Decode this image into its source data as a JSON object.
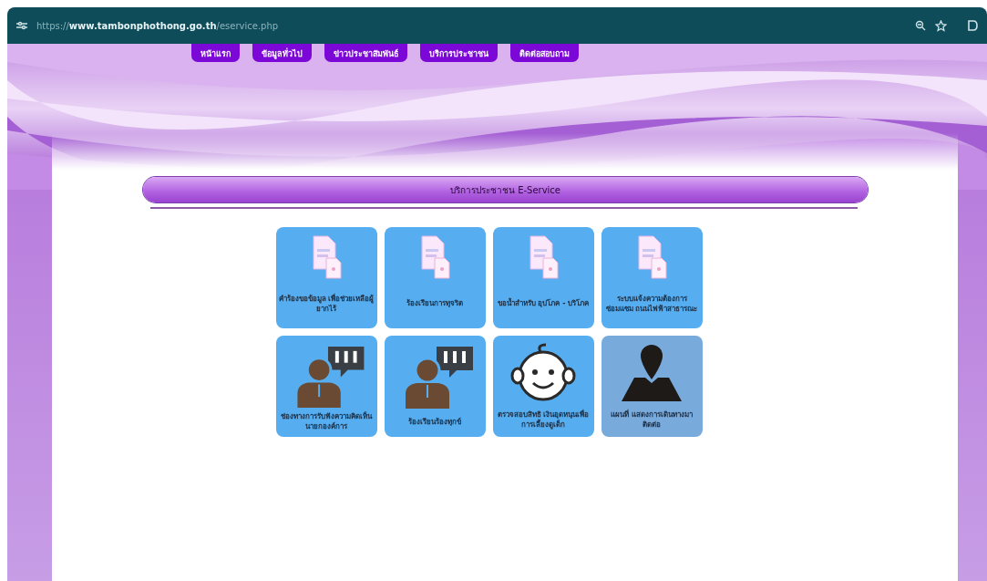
{
  "browser": {
    "url_scheme": "https://",
    "url_host": "www.tambonphothong.go.th",
    "url_path": "/eservice.php"
  },
  "nav": [
    "หน้าแรก",
    "ข้อมูลทั่วไป",
    "ข่าวประชาสัมพันธ์",
    "บริการประชาชน",
    "ติดต่อสอบถาม"
  ],
  "section_title": "บริการประชาชน E-Service",
  "services": [
    {
      "kind": "document",
      "label": "คำร้องขอข้อมูล เพื่อช่วยเหลือผู้ยากไร้"
    },
    {
      "kind": "document",
      "label": "ร้องเรียนการทุจริต"
    },
    {
      "kind": "document",
      "label": "ขอน้ำสำหรับ อุปโภค - บริโภค"
    },
    {
      "kind": "document",
      "label": "ระบบแจ้งความต้องการซ่อมแซม ถนนไฟฟ้าสาธารณะ"
    },
    {
      "kind": "speaker",
      "label": "ช่องทางการรับฟังความคิดเห็น นายกองค์การ"
    },
    {
      "kind": "speaker",
      "label": "ร้องเรียนร้องทุกข์"
    },
    {
      "kind": "baby",
      "label": "ตรวจสอบสิทธิ เงินอุดหนุนเพื่อการเลี้ยงดูเด็ก"
    },
    {
      "kind": "map",
      "label": "แผนที่ แสดงการเดินทางมาติดต่อ"
    }
  ]
}
